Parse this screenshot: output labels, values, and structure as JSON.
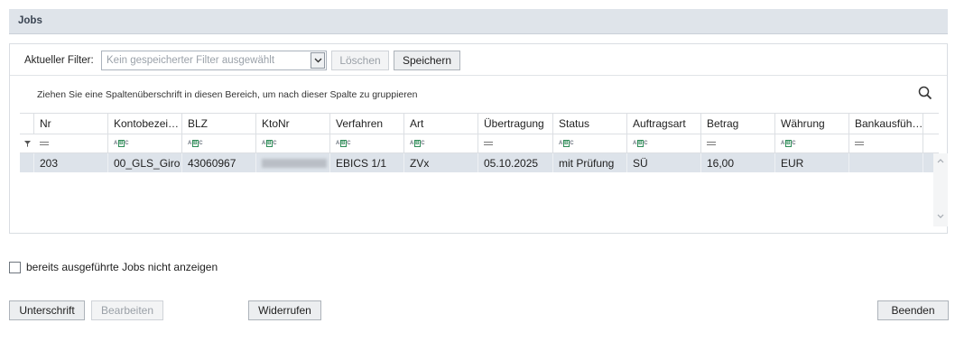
{
  "header": {
    "title": "Jobs"
  },
  "filter": {
    "label": "Aktueller Filter:",
    "combo_placeholder": "Kein gespeicherter Filter ausgewählt",
    "delete_label": "Löschen",
    "save_label": "Speichern"
  },
  "group_hint": "Ziehen Sie eine Spaltenüberschrift in diesen Bereich, um nach dieser Spalte zu gruppieren",
  "table": {
    "columns": [
      "Nr",
      "Kontobezei…",
      "BLZ",
      "KtoNr",
      "Verfahren",
      "Art",
      "Übertragung",
      "Status",
      "Auftragsart",
      "Betrag",
      "Währung",
      "Bankausfüh…"
    ],
    "filter_ops": [
      "eq",
      "abc",
      "abc",
      "abc",
      "abc",
      "abc",
      "eq",
      "abc",
      "abc",
      "eq",
      "abc",
      "eq"
    ],
    "rows": [
      [
        "203",
        "00_GLS_Giro",
        "43060967",
        "",
        "EBICS 1/1",
        "ZVx",
        "05.10.2025",
        "mit Prüfung",
        "SÜ",
        "16,00",
        "EUR",
        ""
      ]
    ]
  },
  "checkbox": {
    "label": "bereits ausgeführte Jobs nicht anzeigen",
    "checked": false
  },
  "buttons": {
    "signature": "Unterschrift",
    "edit": "Bearbeiten",
    "revoke": "Widerrufen",
    "close": "Beenden"
  },
  "icons": {
    "search": "search-icon",
    "dropdown": "chevron-down-icon",
    "filter": "filter-icon",
    "scroll_up": "chevron-up-icon",
    "scroll_down": "chevron-down-icon"
  }
}
